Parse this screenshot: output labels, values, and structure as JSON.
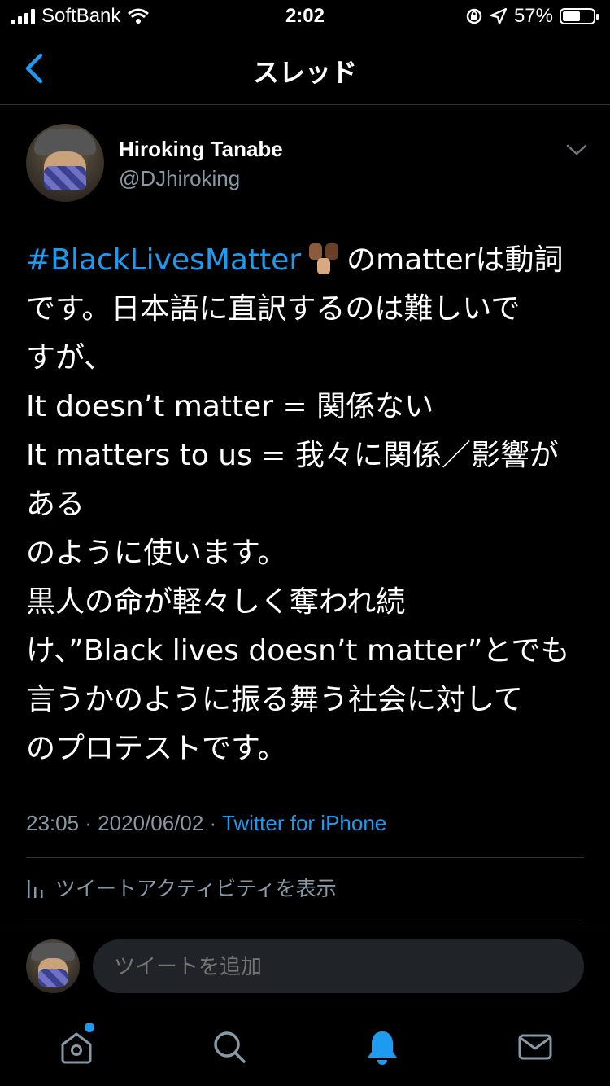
{
  "status_bar": {
    "carrier": "SoftBank",
    "time": "2:02",
    "battery_percent": "57%",
    "battery_level": 0.57
  },
  "nav": {
    "title": "スレッド",
    "back_icon": "chevron-left-icon"
  },
  "tweet": {
    "author_name": "Hiroking Tanabe",
    "author_handle": "@DJhiroking",
    "hashtag": "#BlackLivesMatter",
    "emoji": "raised-fists-emoji",
    "lines": [
      "のmatterは動詞",
      "です。日本語に直訳するのは難しいで",
      "すが、",
      "It doesn’t matter = 関係ない",
      "It matters to us = 我々に関係／影響が",
      "ある",
      "のように使います。",
      "黒人の命が軽々しく奪われ続",
      "け、”Black lives doesn’t matter”とでも",
      "言うかのように振る舞う社会に対して",
      "のプロテストです。"
    ],
    "timestamp": "23:05 · 2020/06/02 · ",
    "source": "Twitter for iPhone",
    "activity_label": "ツイートアクティビティを表示"
  },
  "reply": {
    "placeholder": "ツイートを追加"
  },
  "tabbar": {
    "items": [
      "home-icon",
      "search-icon",
      "notifications-icon",
      "messages-icon"
    ],
    "active": "notifications-icon"
  },
  "colors": {
    "accent": "#1d9bf0",
    "secondary_text": "#8899a6",
    "background": "#000000"
  }
}
